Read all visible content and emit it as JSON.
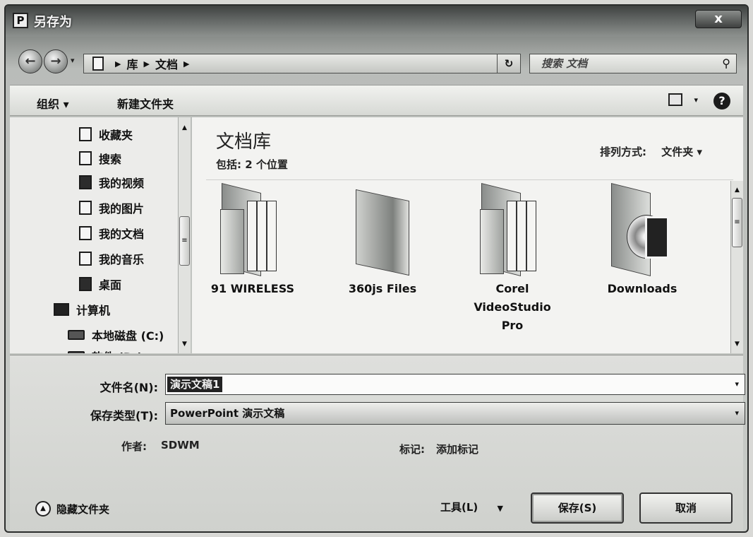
{
  "window": {
    "title": "另存为",
    "app_icon": "P",
    "close": "x"
  },
  "nav": {
    "back_icon": "←",
    "forward_icon": "→",
    "breadcrumbs": [
      "库",
      "文档"
    ],
    "search_placeholder": "搜索 文档",
    "refresh_icon": "↻"
  },
  "toolbar": {
    "organize": "组织 ▾",
    "new_folder": "新建文件夹",
    "help": "?"
  },
  "sidebar": {
    "items": [
      {
        "label": "收藏夹",
        "icon": "favorites-icon"
      },
      {
        "label": "搜索",
        "icon": "search-folder-icon"
      },
      {
        "label": "我的视频",
        "icon": "videos-icon"
      },
      {
        "label": "我的图片",
        "icon": "pictures-icon"
      },
      {
        "label": "我的文档",
        "icon": "documents-icon"
      },
      {
        "label": "我的音乐",
        "icon": "music-icon"
      },
      {
        "label": "桌面",
        "icon": "desktop-icon"
      },
      {
        "label": "计算机",
        "icon": "computer-icon"
      },
      {
        "label": "本地磁盘 (C:)",
        "icon": "drive-icon"
      },
      {
        "label": "软件 (D:)",
        "icon": "drive-icon"
      }
    ]
  },
  "content": {
    "library_title": "文档库",
    "includes": "包括: 2 个位置",
    "arrange_label": "排列方式:",
    "arrange_value": "文件夹 ▾",
    "folders": [
      {
        "name": "91 WIRELESS",
        "style": "files"
      },
      {
        "name": "360js Files",
        "style": "flat"
      },
      {
        "name": "Corel VideoStudio Pro",
        "style": "files"
      },
      {
        "name": "Downloads",
        "style": "media"
      }
    ]
  },
  "form": {
    "filename_label": "文件名(N):",
    "filename_value": "演示文稿1",
    "filetype_label": "保存类型(T):",
    "filetype_value": "PowerPoint 演示文稿",
    "author_label": "作者:",
    "author_value": "SDWM",
    "tags_label": "标记:",
    "tags_value": "添加标记"
  },
  "footer": {
    "hide_folders": "隐藏文件夹",
    "tools": "工具(L)",
    "save": "保存(S)",
    "cancel": "取消"
  }
}
